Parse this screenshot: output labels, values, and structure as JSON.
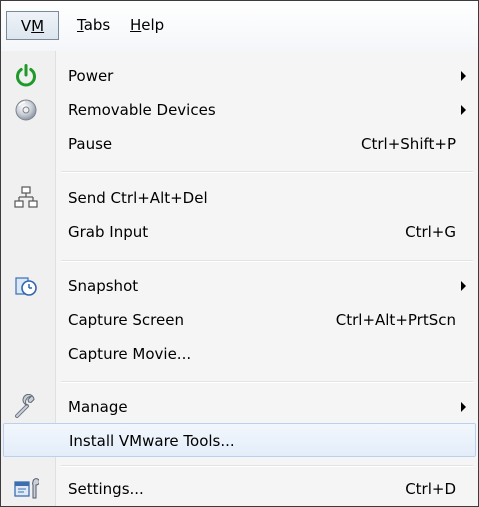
{
  "menubar": {
    "vm": "VM",
    "tabs": "Tabs",
    "help": "Help"
  },
  "menu": {
    "power": {
      "label": "Power",
      "icon": "power-icon"
    },
    "removable_devices": {
      "label": "Removable Devices",
      "icon": "disc-icon"
    },
    "pause": {
      "label": "Pause",
      "shortcut": "Ctrl+Shift+P"
    },
    "send_cad": {
      "label": "Send Ctrl+Alt+Del",
      "icon": "network-icon"
    },
    "grab_input": {
      "label": "Grab Input",
      "shortcut": "Ctrl+G"
    },
    "snapshot": {
      "label": "Snapshot",
      "icon": "snapshot-clock-icon"
    },
    "capture_screen": {
      "label": "Capture Screen",
      "shortcut": "Ctrl+Alt+PrtScn"
    },
    "capture_movie": {
      "label": "Capture Movie..."
    },
    "manage": {
      "label": "Manage",
      "icon": "wrench-icon"
    },
    "install_tools": {
      "label": "Install VMware Tools..."
    },
    "settings": {
      "label": "Settings...",
      "shortcut": "Ctrl+D",
      "icon": "settings-icon"
    }
  },
  "colors": {
    "highlight_bg": "#e3edf9",
    "highlight_border": "#b9d1ec",
    "power_green": "#1f9a2a"
  }
}
